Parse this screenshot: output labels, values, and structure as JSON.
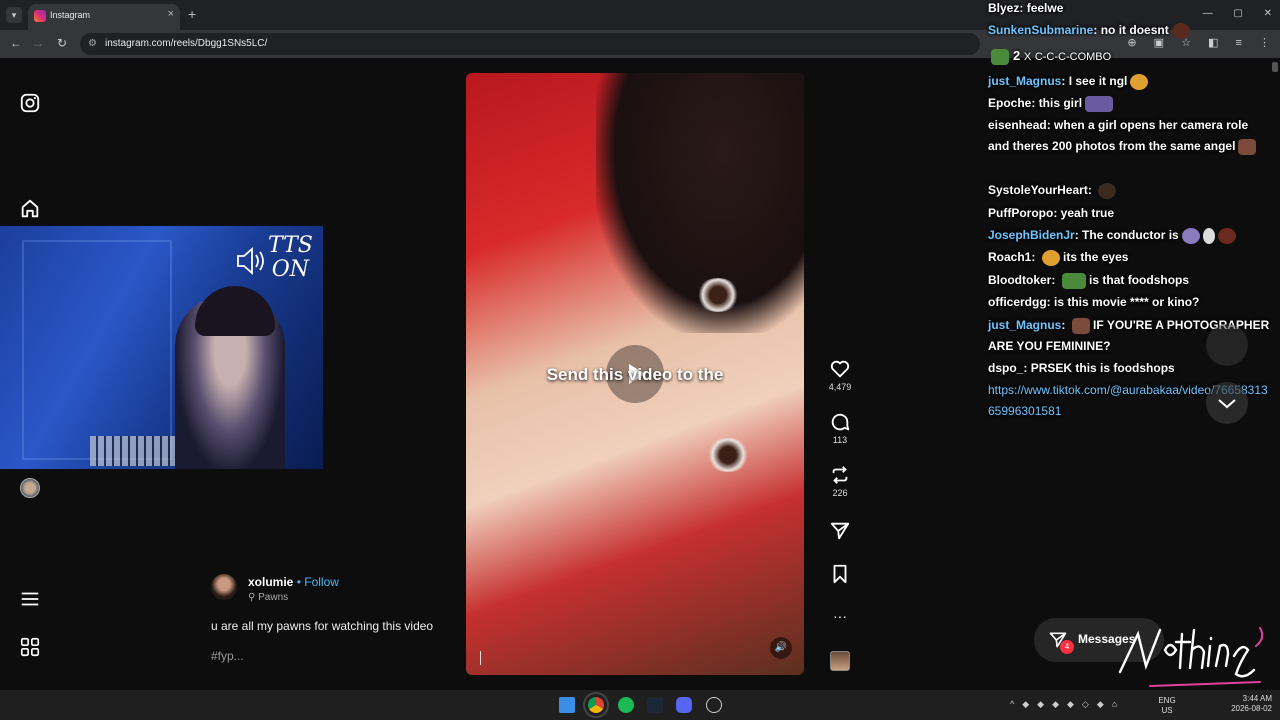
{
  "browser": {
    "tab_title": "Instagram",
    "tab_close": "×",
    "new_tab": "+",
    "url": "instagram.com/reels/Dbgg1SNs5LC/"
  },
  "reel": {
    "caption_overlay": "Send this video to the",
    "likes": "4,479",
    "comments": "113",
    "reposts": "226",
    "more": "···"
  },
  "post": {
    "username": "xolumie",
    "follow": "• Follow",
    "location": "Pawns",
    "text": "u are all my pawns for watching this video",
    "tag": "#fyp..."
  },
  "messages": {
    "label": "Messages",
    "badge": "4"
  },
  "stream": {
    "tts_line1": "TTS",
    "tts_line2": "ON"
  },
  "chat": {
    "lines": [
      {
        "user": "Blyez",
        "msg": "feelwe"
      },
      {
        "user": "SunkenSubmarine",
        "msg": "no it doesnt"
      },
      {
        "combo_count": "2",
        "combo_x": "X",
        "combo_text": "C-C-C-COMBO"
      },
      {
        "user": "just_Magnus",
        "msg": "I see it ngl"
      },
      {
        "user": "Epoche",
        "msg": "this girl"
      },
      {
        "user": "eisenhead",
        "msg": "when a girl opens her camera role and theres 200 photos from the same angel"
      },
      {
        "user": "SystoleYourHeart",
        "msg": ""
      },
      {
        "user": "PuffPoropo",
        "msg": "yeah true"
      },
      {
        "user": "JosephBidenJr",
        "msg": "The conductor is"
      },
      {
        "user": "Roach1",
        "msg": "its the eyes"
      },
      {
        "user": "Bloodtoker",
        "msg": "is that foodshops"
      },
      {
        "user": "officerdgg",
        "msg": "is this movie **** or kino?"
      },
      {
        "user": "just_Magnus",
        "msg": "IF YOU'RE A PHOTOGRAPHER ARE YOU FEMININE?"
      },
      {
        "user": "dspo_",
        "msg": "PRSEK this is foodshops"
      },
      {
        "link": "https://www.tiktok.com/@aurabakaa/video/7665831365996301581"
      }
    ]
  },
  "taskbar": {
    "lang1": "ENG",
    "lang2": "US",
    "time": "3:44 AM",
    "date": "2026-08-02"
  },
  "colors": {
    "accent_blue": "#4cb5f9",
    "chat_blue_user": "#6ec4ff",
    "badge_red": "#ff3040"
  }
}
